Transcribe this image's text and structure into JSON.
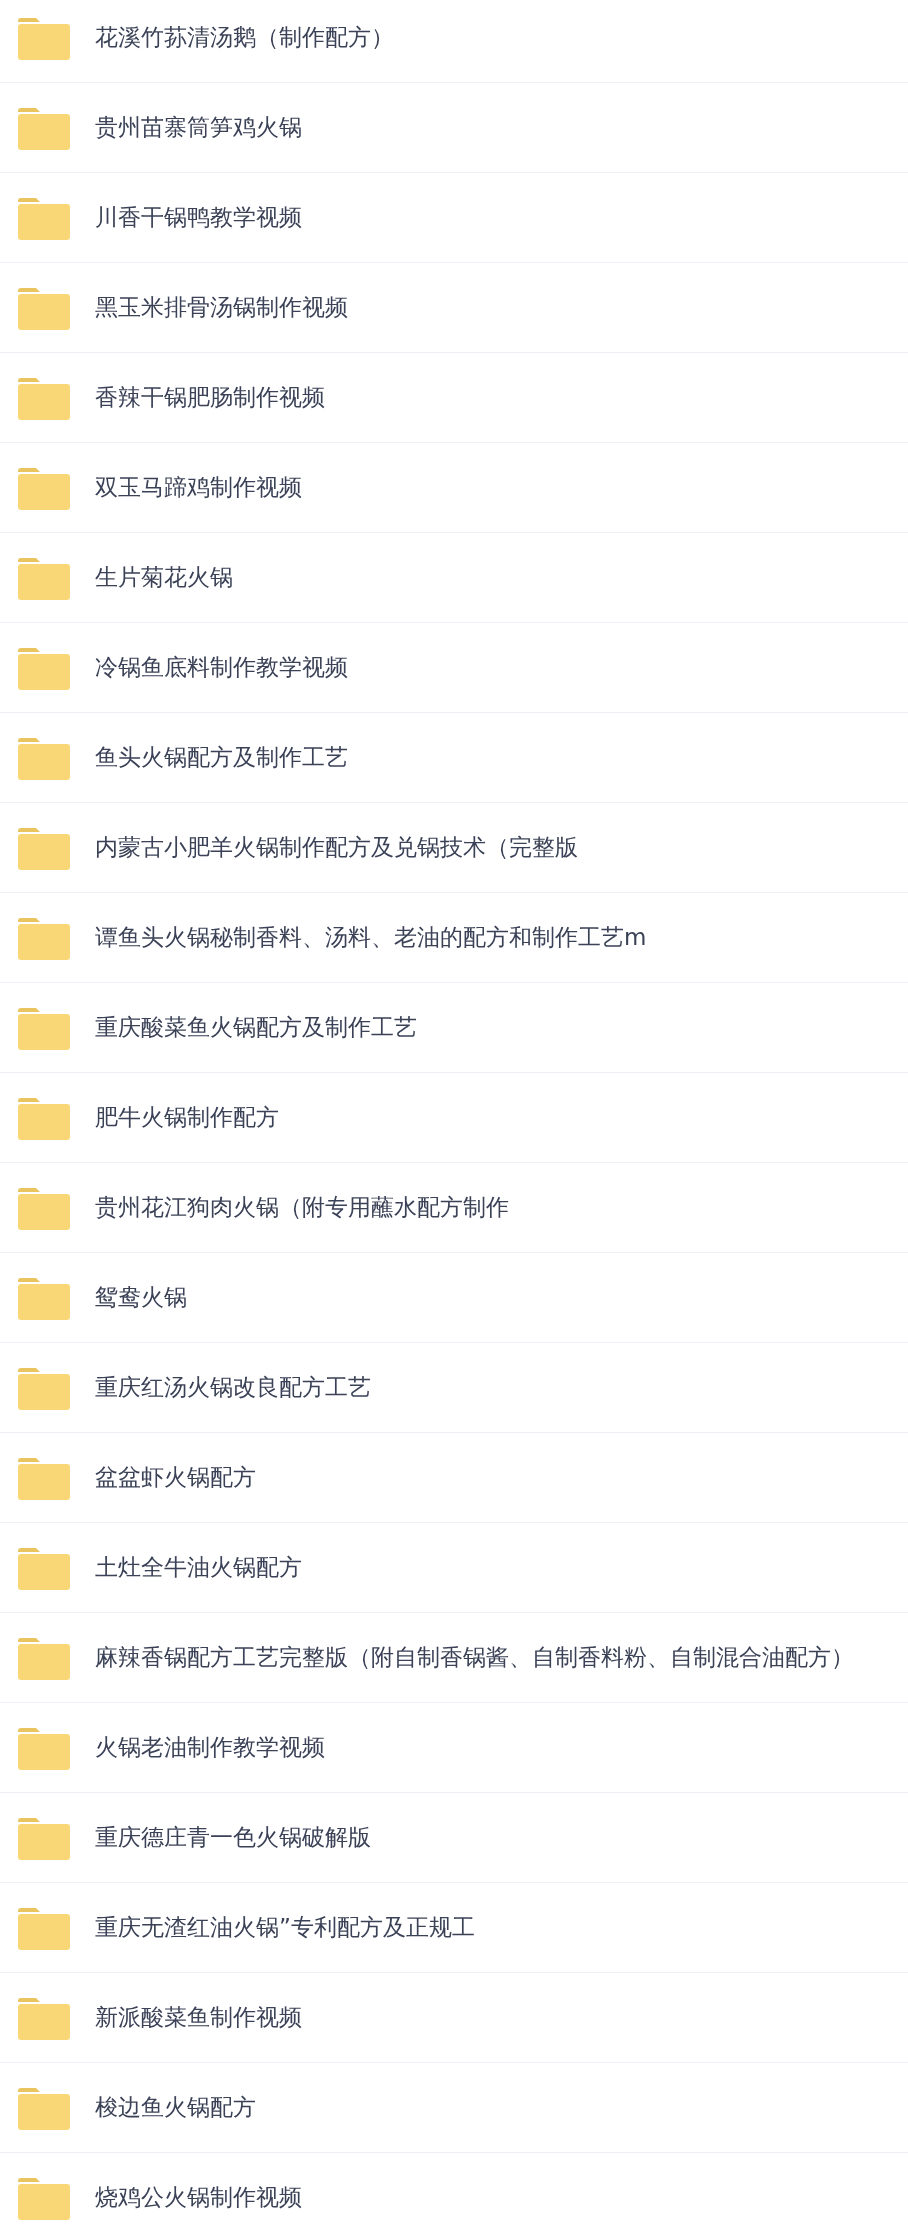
{
  "folders": [
    {
      "name": "花溪竹荪清汤鹅（制作配方）"
    },
    {
      "name": "贵州苗寨筒笋鸡火锅"
    },
    {
      "name": "川香干锅鸭教学视频"
    },
    {
      "name": "黑玉米排骨汤锅制作视频"
    },
    {
      "name": "香辣干锅肥肠制作视频"
    },
    {
      "name": "双玉马蹄鸡制作视频"
    },
    {
      "name": "生片菊花火锅"
    },
    {
      "name": "冷锅鱼底料制作教学视频"
    },
    {
      "name": "鱼头火锅配方及制作工艺"
    },
    {
      "name": "内蒙古小肥羊火锅制作配方及兑锅技术（完整版"
    },
    {
      "name": "谭鱼头火锅秘制香料、汤料、老油的配方和制作工艺m"
    },
    {
      "name": "重庆酸菜鱼火锅配方及制作工艺"
    },
    {
      "name": "肥牛火锅制作配方"
    },
    {
      "name": "贵州花江狗肉火锅（附专用蘸水配方制作"
    },
    {
      "name": "鸳鸯火锅"
    },
    {
      "name": "重庆红汤火锅改良配方工艺"
    },
    {
      "name": "盆盆虾火锅配方"
    },
    {
      "name": "土灶全牛油火锅配方"
    },
    {
      "name": "麻辣香锅配方工艺完整版（附自制香锅酱、自制香料粉、自制混合油配方）"
    },
    {
      "name": "火锅老油制作教学视频"
    },
    {
      "name": "重庆德庄青一色火锅破解版"
    },
    {
      "name": "重庆无渣红油火锅”专利配方及正规工"
    },
    {
      "name": "新派酸菜鱼制作视频"
    },
    {
      "name": "梭边鱼火锅配方"
    },
    {
      "name": "烧鸡公火锅制作视频"
    }
  ]
}
